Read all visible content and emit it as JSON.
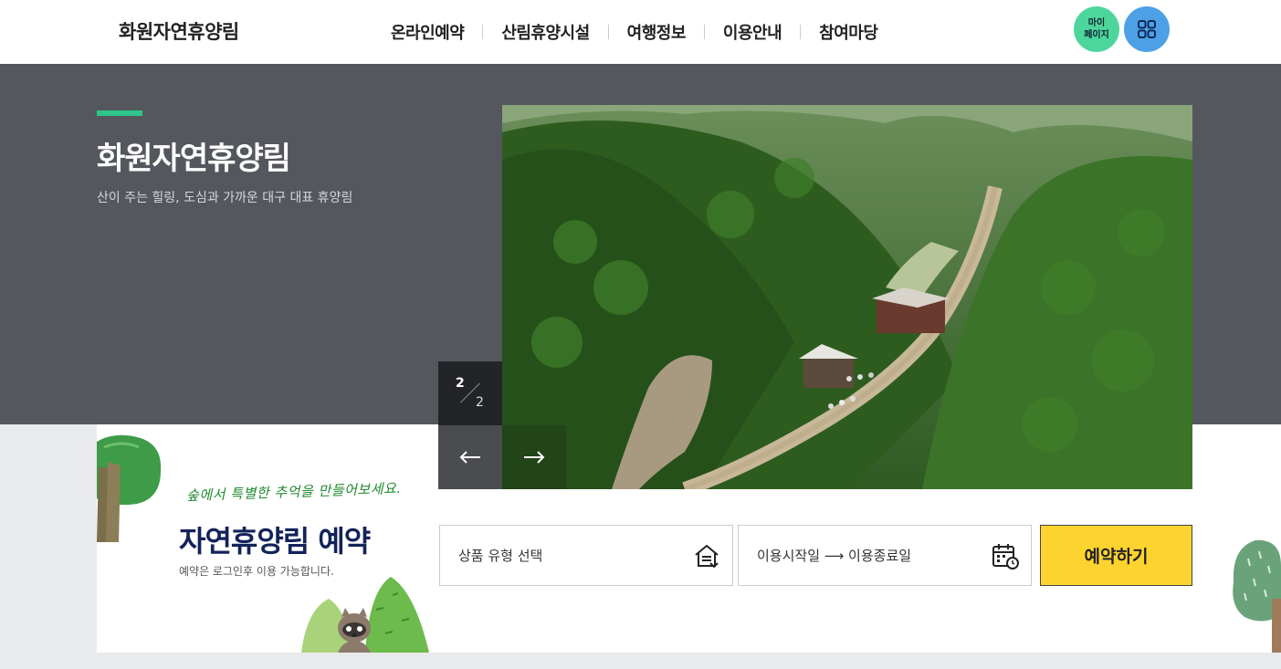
{
  "header": {
    "logo": "화원자연휴양림",
    "nav": [
      {
        "label": "온라인예약"
      },
      {
        "label": "산림휴양시설"
      },
      {
        "label": "여행정보"
      },
      {
        "label": "이용안내"
      },
      {
        "label": "참여마당"
      }
    ],
    "mypage_line1": "마이",
    "mypage_line2": "페이지",
    "allmenu_icon": "grid-menu-icon"
  },
  "hero": {
    "title": "화원자연휴양림",
    "subtitle": "산이 주는 힐링, 도심과 가까운 대구 대표 휴양림",
    "slide_current": "2",
    "slide_total": "2",
    "prev_icon": "arrow-left-icon",
    "next_icon": "arrow-right-icon"
  },
  "reservation": {
    "tagline": "숲에서 특별한 추억을 만들어보세요.",
    "title": "자연휴양림 예약",
    "note": "예약은 로그인후 이용 가능합니다.",
    "product_type_label": "상품 유형 선택",
    "date_range_label": "이용시작일 ⟶ 이용종료일",
    "submit_label": "예약하기"
  },
  "colors": {
    "accent_green": "#2ec58c",
    "hero_bg": "#54575d",
    "reserve_yellow": "#fdd42f",
    "mypage_green": "#4dd69c",
    "menu_blue": "#4da0e6"
  }
}
